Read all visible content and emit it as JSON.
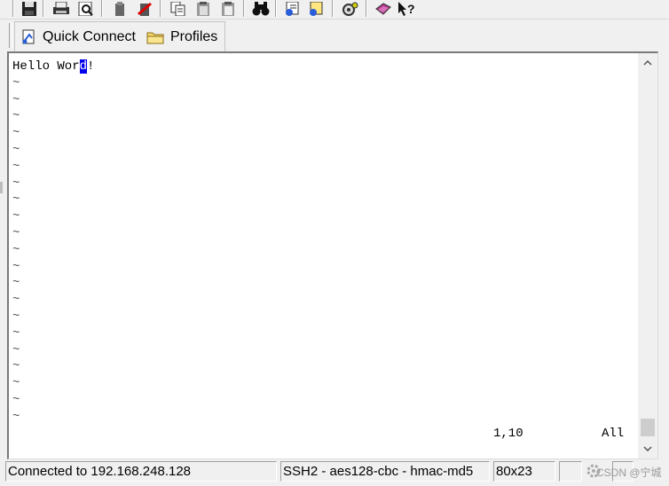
{
  "toolbar": {
    "buttons": [
      {
        "name": "save-icon"
      },
      {
        "name": "print-icon"
      },
      {
        "name": "print-preview-icon"
      },
      {
        "name": "disconnect-icon"
      },
      {
        "name": "reconnect-icon"
      },
      {
        "name": "copy-icon"
      },
      {
        "name": "paste-icon"
      },
      {
        "name": "copy-paste-icon"
      },
      {
        "name": "find-icon"
      },
      {
        "name": "session-options-icon"
      },
      {
        "name": "global-options-icon"
      },
      {
        "name": "keymap-icon"
      },
      {
        "name": "help-book-icon"
      },
      {
        "name": "context-help-icon"
      }
    ]
  },
  "buttonbar": {
    "quick_connect_label": "Quick Connect",
    "profiles_label": "Profiles"
  },
  "terminal": {
    "first_line_before_cursor": "Hello Wor",
    "cursor_char": "d",
    "first_line_after_cursor": "!",
    "tilde": "~",
    "tilde_line_count": 21,
    "vim_position": "1,10",
    "vim_percent": "All"
  },
  "statusbar": {
    "connection": "Connected to 192.168.248.128",
    "cipher": "SSH2 - aes128-cbc - hmac-md5",
    "size": "80x23",
    "watermark": "CSDN @宁城"
  },
  "colors": {
    "cursor_bg": "#0000ee",
    "terminal_bg": "#ffffff",
    "chrome_bg": "#f0f0f0"
  }
}
